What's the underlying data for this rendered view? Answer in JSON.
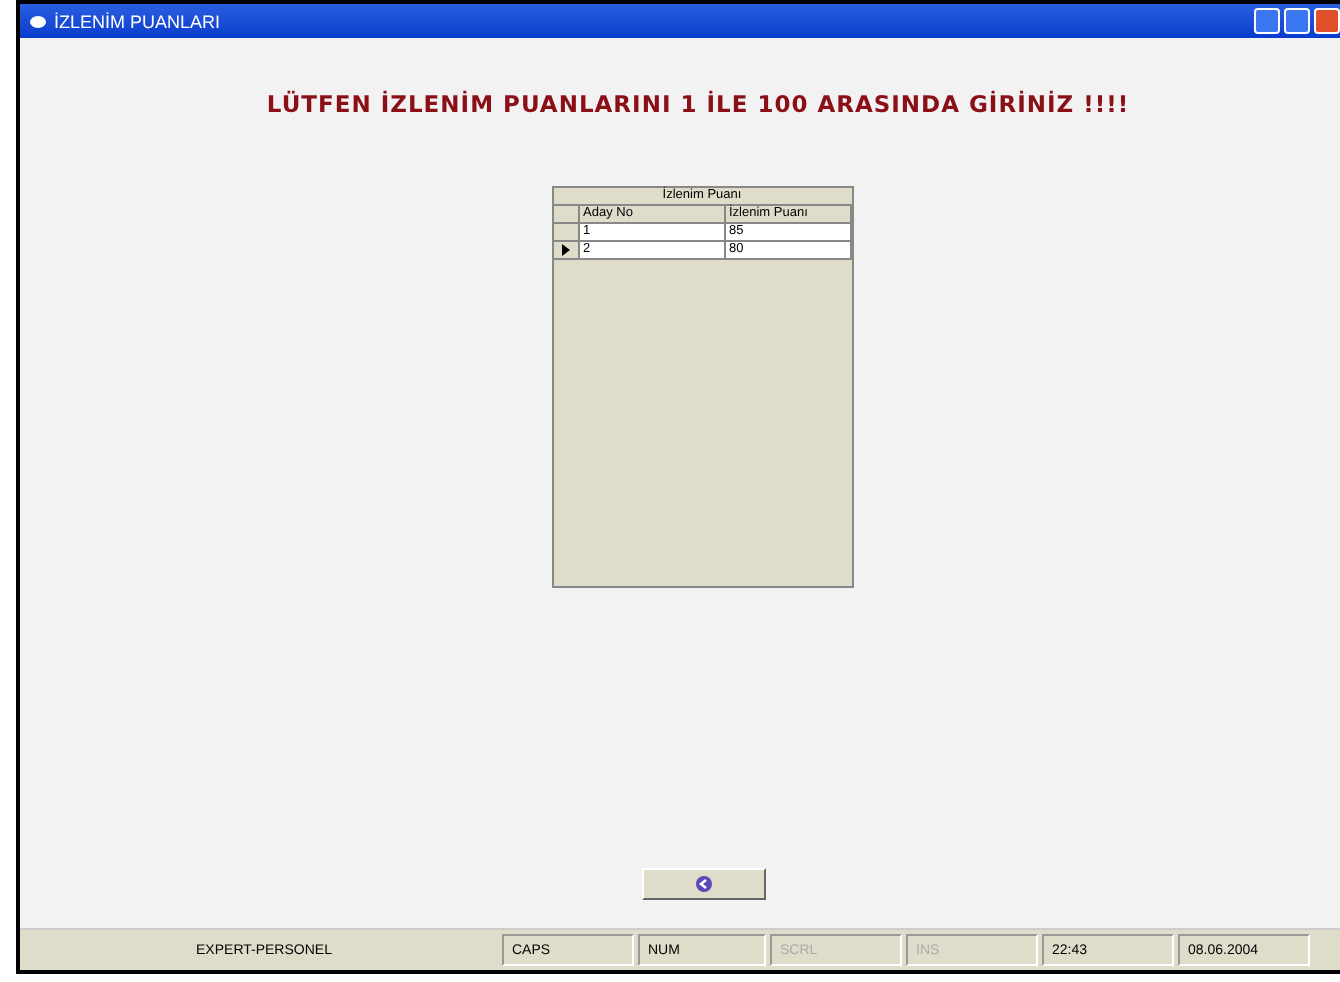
{
  "window": {
    "title": "İZLENİM PUANLARI"
  },
  "heading": "LÜTFEN İZLENİM PUANLARINI 1 İLE 100 ARASINDA GİRİNİZ !!!!",
  "grid": {
    "band": "İzlenim Puanı",
    "columns": [
      "Aday No",
      "İzlenim Puanı"
    ],
    "rows": [
      {
        "cells": [
          "1",
          "85"
        ],
        "selected": false
      },
      {
        "cells": [
          "2",
          "80"
        ],
        "selected": true
      }
    ]
  },
  "status_bar": [
    {
      "text": "EXPERT-PERSONEL",
      "enabled": true
    },
    {
      "text": "CAPS",
      "enabled": true
    },
    {
      "text": "NUM",
      "enabled": true
    },
    {
      "text": "SCRL",
      "enabled": false
    },
    {
      "text": "INS",
      "enabled": false
    },
    {
      "text": "22:43",
      "enabled": true
    },
    {
      "text": "08.06.2004",
      "enabled": true
    }
  ]
}
